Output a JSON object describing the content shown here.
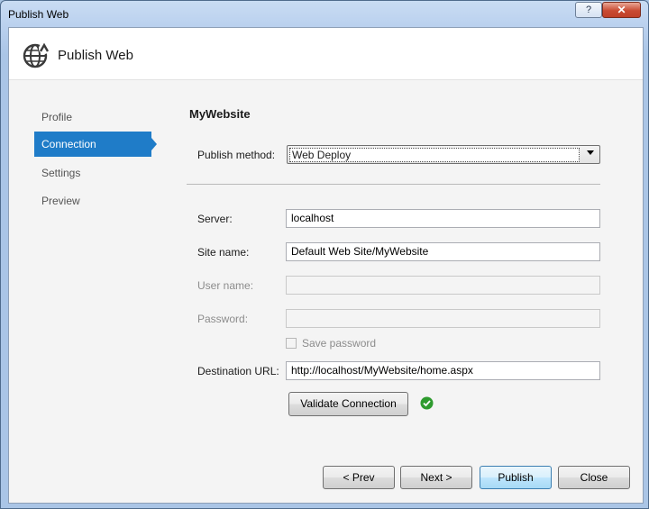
{
  "window": {
    "title": "Publish Web",
    "help_label": "?",
    "close_label": "✕"
  },
  "header": {
    "title": "Publish Web",
    "icon": "globe-publish-icon"
  },
  "nav": [
    {
      "label": "Profile",
      "active": false
    },
    {
      "label": "Connection",
      "active": true
    },
    {
      "label": "Settings",
      "active": false
    },
    {
      "label": "Preview",
      "active": false
    }
  ],
  "connection": {
    "profile_name": "MyWebsite",
    "publish_method": {
      "label": "Publish method:",
      "value": "Web Deploy"
    },
    "server": {
      "label": "Server:",
      "value": "localhost"
    },
    "site_name": {
      "label": "Site name:",
      "value": "Default Web Site/MyWebsite"
    },
    "user_name": {
      "label": "User name:",
      "value": "",
      "enabled": false
    },
    "password": {
      "label": "Password:",
      "value": "",
      "enabled": false
    },
    "save_password": {
      "label": "Save password",
      "checked": false,
      "enabled": false
    },
    "destination_url": {
      "label": "Destination URL:",
      "value": "http://localhost/MyWebsite/home.aspx"
    },
    "validate_button": "Validate Connection",
    "validation_status": "success",
    "status_color": "#2e9b2e"
  },
  "footer": {
    "prev": "< Prev",
    "next": "Next >",
    "publish": "Publish",
    "close": "Close"
  },
  "colors": {
    "accent": "#1f7cc8"
  }
}
